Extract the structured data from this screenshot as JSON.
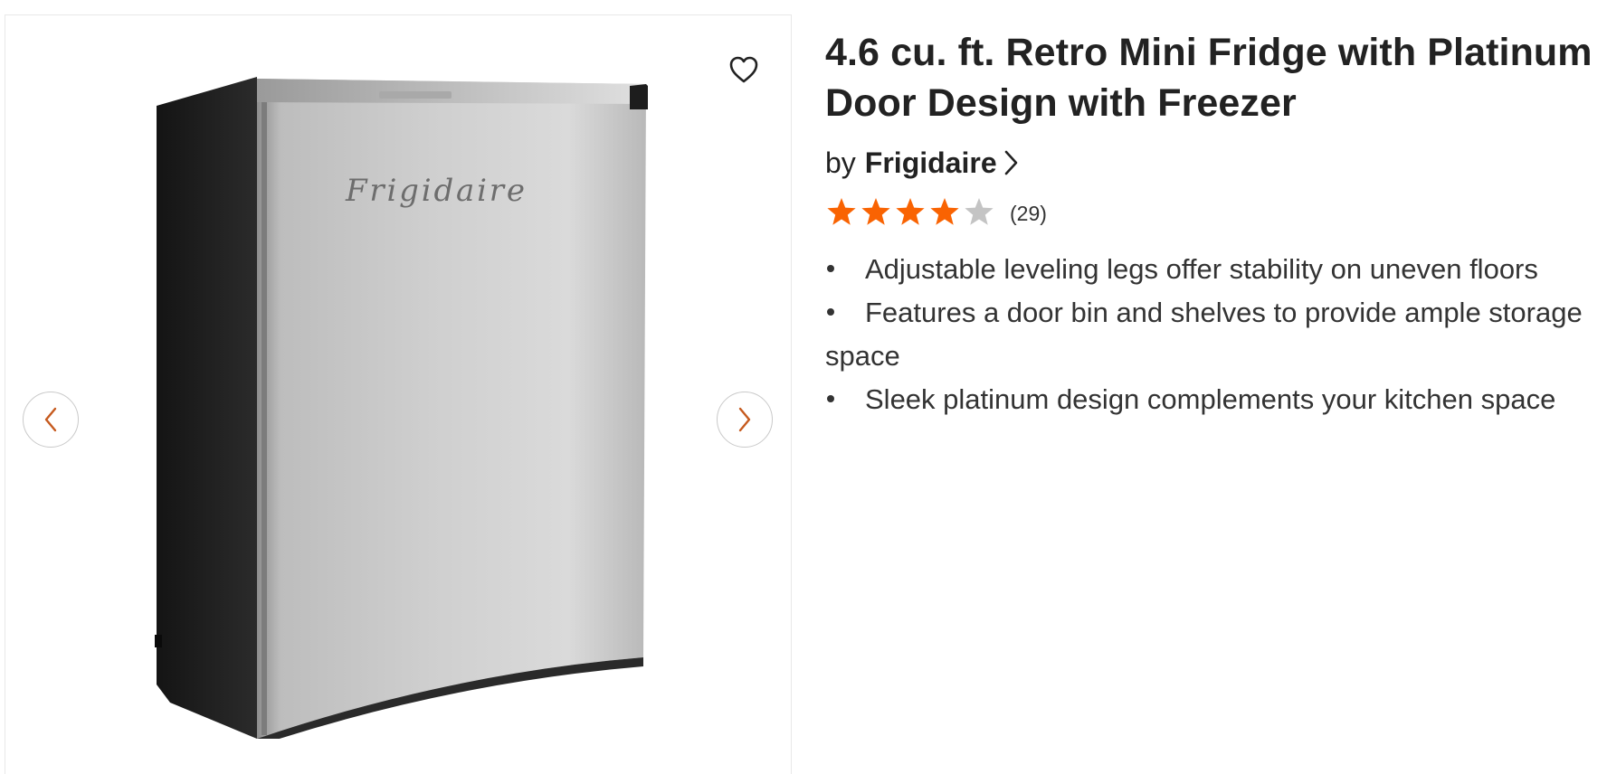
{
  "gallery": {
    "image_name": "frigidaire-retro-mini-fridge",
    "logo_script": "Frigidaire",
    "favorite_icon": "heart-icon",
    "prev_icon": "chevron-left-icon",
    "next_icon": "chevron-right-icon",
    "accent_color": "#f96302"
  },
  "product": {
    "title": "4.6 cu. ft. Retro Mini Fridge with Platinum Door Design with Freezer",
    "by_label": "by",
    "brand": "Frigidaire",
    "brand_icon": "chevron-right-icon",
    "rating": 3.9,
    "rating_max": 5,
    "review_count": "(29)",
    "star_color": "#f96302",
    "star_empty_color": "#c4c4c4",
    "highlights": [
      "Adjustable leveling legs offer stability on uneven floors",
      "Features a door bin and shelves to provide ample storage space",
      "Sleek platinum design complements your kitchen space"
    ]
  }
}
